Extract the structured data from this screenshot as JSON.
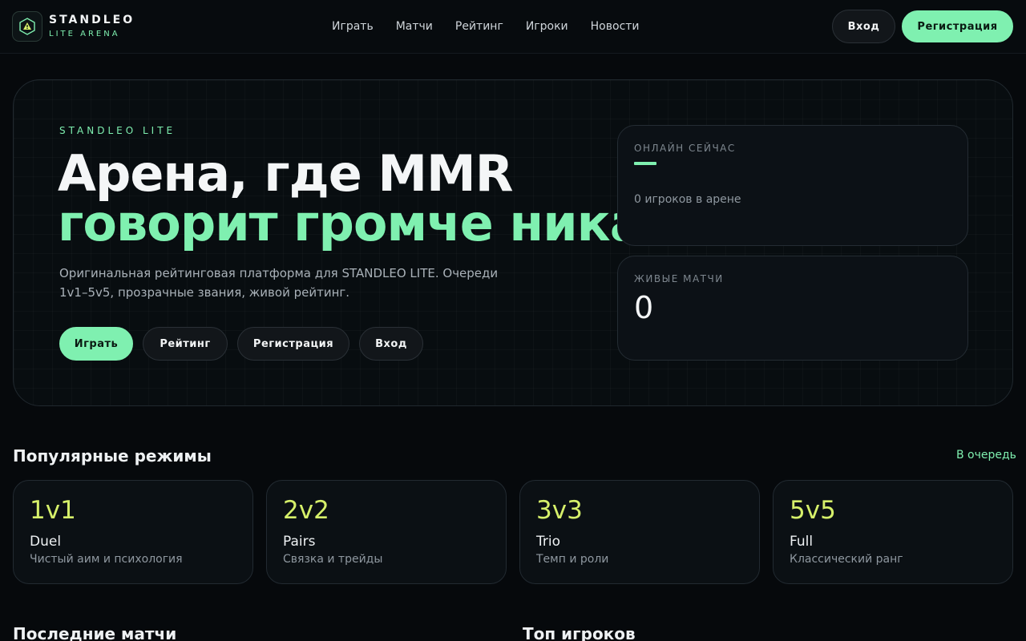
{
  "colors": {
    "accent": "#7ff0b0",
    "mode_accent": "#d6f06a",
    "background": "#06090c"
  },
  "brand": {
    "title": "STANDLEO",
    "subtitle": "LITE ARENA",
    "logo_icon": "triangle-alert-icon"
  },
  "nav": [
    {
      "label": "Играть"
    },
    {
      "label": "Матчи"
    },
    {
      "label": "Рейтинг"
    },
    {
      "label": "Игроки"
    },
    {
      "label": "Новости"
    }
  ],
  "header_actions": {
    "login_label": "Вход",
    "register_label": "Регистрация"
  },
  "hero": {
    "eyebrow": "STANDLEO LITE",
    "title_line1": "Арена, где MMR",
    "title_line2": "говорит громче ника",
    "description": "Оригинальная рейтинговая платформа для STANDLEO LITE. Очереди 1v1–5v5, прозрачные звания, живой рейтинг.",
    "buttons": {
      "play": "Играть",
      "rating": "Рейтинг",
      "register": "Регистрация",
      "login": "Вход"
    }
  },
  "stats": {
    "online": {
      "label": "ОНЛАЙН СЕЙЧАС",
      "sub": "0 игроков в арене"
    },
    "live": {
      "label": "ЖИВЫЕ МАТЧИ",
      "value": "0"
    }
  },
  "modes": {
    "title": "Популярные режимы",
    "link": "В очередь",
    "items": [
      {
        "num": "1v1",
        "name": "Duel",
        "desc": "Чистый аим и психология"
      },
      {
        "num": "2v2",
        "name": "Pairs",
        "desc": "Связка и трейды"
      },
      {
        "num": "3v3",
        "name": "Trio",
        "desc": "Темп и роли"
      },
      {
        "num": "5v5",
        "name": "Full",
        "desc": "Классический ранг"
      }
    ]
  },
  "sections": {
    "recent_matches": "Последние матчи",
    "top_players": "Топ игроков"
  }
}
